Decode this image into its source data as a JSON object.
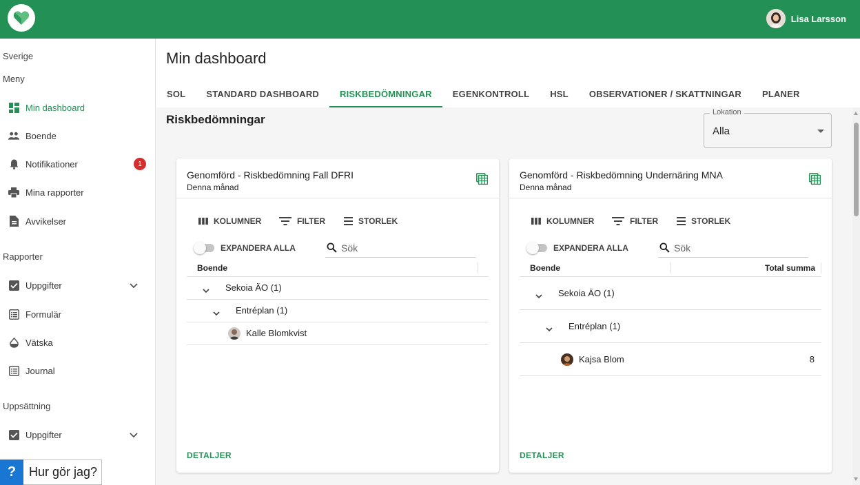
{
  "user": {
    "name": "Lisa Larsson"
  },
  "sidebar": {
    "country": "Sverige",
    "menu_heading": "Meny",
    "items": [
      {
        "label": "Min dashboard",
        "icon": "dashboard-icon",
        "active": true
      },
      {
        "label": "Boende",
        "icon": "people-icon"
      },
      {
        "label": "Notifikationer",
        "icon": "bell-icon",
        "badge": "1"
      },
      {
        "label": "Mina rapporter",
        "icon": "printer-icon"
      },
      {
        "label": "Avvikelser",
        "icon": "document-icon"
      }
    ],
    "reports_heading": "Rapporter",
    "report_items": [
      {
        "label": "Uppgifter",
        "icon": "checkbox-icon",
        "expandable": true
      },
      {
        "label": "Formulär",
        "icon": "list-icon"
      },
      {
        "label": "Vätska",
        "icon": "drop-icon"
      },
      {
        "label": "Journal",
        "icon": "list-icon"
      }
    ],
    "setup_heading": "Uppsättning",
    "setup_items": [
      {
        "label": "Uppgifter",
        "icon": "checkbox-icon",
        "expandable": true
      }
    ]
  },
  "help": {
    "label": "Hur gör jag?",
    "icon": "question-icon"
  },
  "main": {
    "title": "Min dashboard",
    "tabs": [
      {
        "label": "SOL"
      },
      {
        "label": "STANDARD DASHBOARD"
      },
      {
        "label": "RISKBEDÖMNINGAR",
        "active": true
      },
      {
        "label": "EGENKONTROLL"
      },
      {
        "label": "HSL"
      },
      {
        "label": "OBSERVATIONER / SKATTNINGAR"
      },
      {
        "label": "PLANER"
      }
    ],
    "section_title": "Riskbedömningar",
    "location": {
      "label": "Lokation",
      "value": "Alla"
    }
  },
  "cards": [
    {
      "title": "Genomförd - Riskbedömning Fall DFRI",
      "subtitle": "Denna månad",
      "toolbar": {
        "columns": "KOLUMNER",
        "filter": "FILTER",
        "size": "STORLEK"
      },
      "expand_all": "EXPANDERA ALLA",
      "search_placeholder": "Sök",
      "col_boende": "Boende",
      "rows": [
        {
          "label": "Sekoia ÄO (1)"
        },
        {
          "label": "Entréplan (1)"
        },
        {
          "label": "Kalle Blomkvist"
        }
      ],
      "details": "DETALJER"
    },
    {
      "title": "Genomförd - Riskbedömning Undernäring MNA",
      "subtitle": "Denna månad",
      "toolbar": {
        "columns": "KOLUMNER",
        "filter": "FILTER",
        "size": "STORLEK"
      },
      "expand_all": "EXPANDERA ALLA",
      "search_placeholder": "Sök",
      "col_boende": "Boende",
      "col_total": "Total summa",
      "rows": [
        {
          "label": "Sekoia ÄO (1)"
        },
        {
          "label": "Entréplan (1)"
        },
        {
          "label": "Kajsa Blom",
          "value": "8"
        }
      ],
      "details": "DETALJER"
    }
  ],
  "colors": {
    "brand": "#239155",
    "badge": "#d32f2f",
    "help": "#1976d2"
  }
}
